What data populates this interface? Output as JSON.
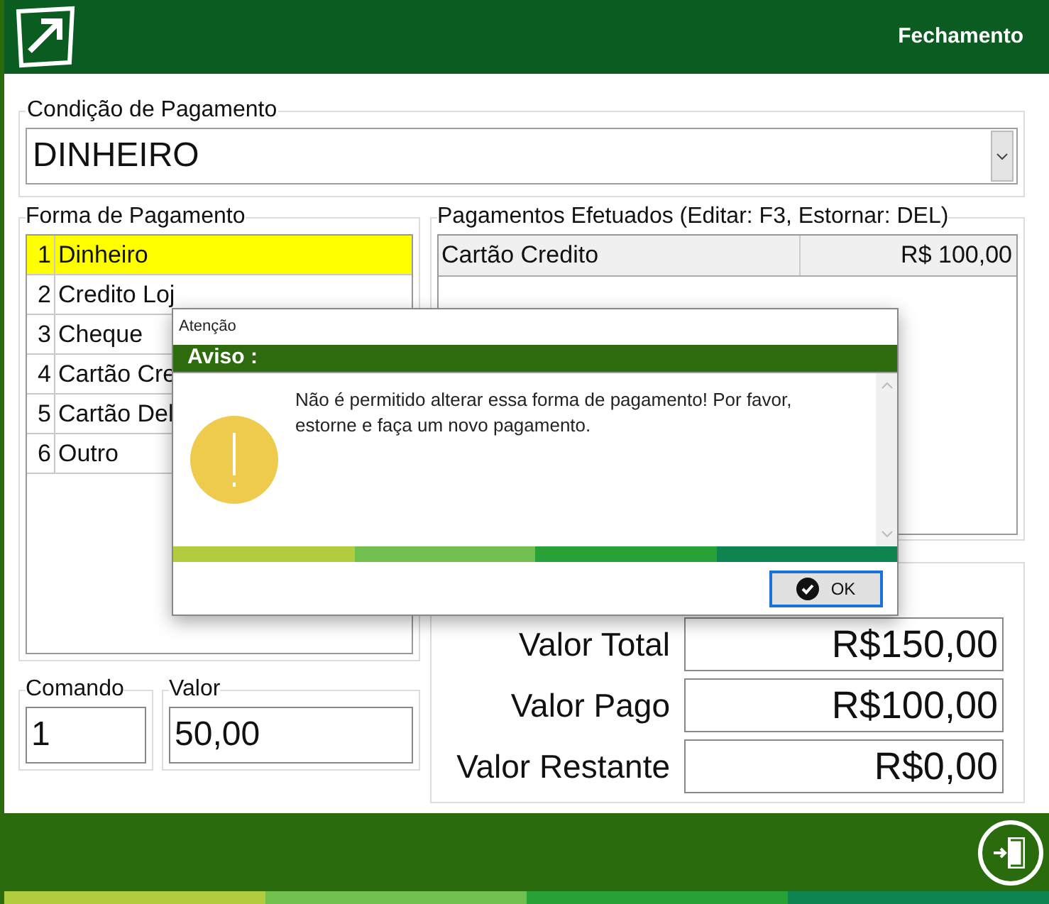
{
  "header": {
    "title": "Fechamento"
  },
  "payment_condition": {
    "label": "Condição de Pagamento",
    "value": "DINHEIRO"
  },
  "payment_methods": {
    "label": "Forma de Pagamento",
    "items": [
      {
        "number": "1",
        "name": "Dinheiro",
        "selected": true
      },
      {
        "number": "2",
        "name": "Credito Loj",
        "selected": false
      },
      {
        "number": "3",
        "name": "Cheque",
        "selected": false
      },
      {
        "number": "4",
        "name": "Cartão Cre",
        "selected": false
      },
      {
        "number": "5",
        "name": "Cartão Del",
        "selected": false
      },
      {
        "number": "6",
        "name": "Outro",
        "selected": false
      }
    ]
  },
  "payments_made": {
    "label": "Pagamentos Efetuados (Editar: F3, Estornar: DEL)",
    "rows": [
      {
        "method": "Cartão Credito",
        "amount": "R$ 100,00"
      }
    ]
  },
  "command": {
    "label": "Comando",
    "value": "1"
  },
  "amount": {
    "label": "Valor",
    "value": "50,00"
  },
  "totals": [
    {
      "label": "Valor Total",
      "value": "R$150,00"
    },
    {
      "label": "Valor Pago",
      "value": "R$100,00"
    },
    {
      "label": "Valor Restante",
      "value": "R$0,00"
    }
  ],
  "dialog": {
    "title": "Atenção",
    "heading": "Aviso :",
    "message": "Não é permitido alterar essa forma de pagamento! Por favor, estorne e faça um novo pagamento.",
    "button": "OK"
  }
}
